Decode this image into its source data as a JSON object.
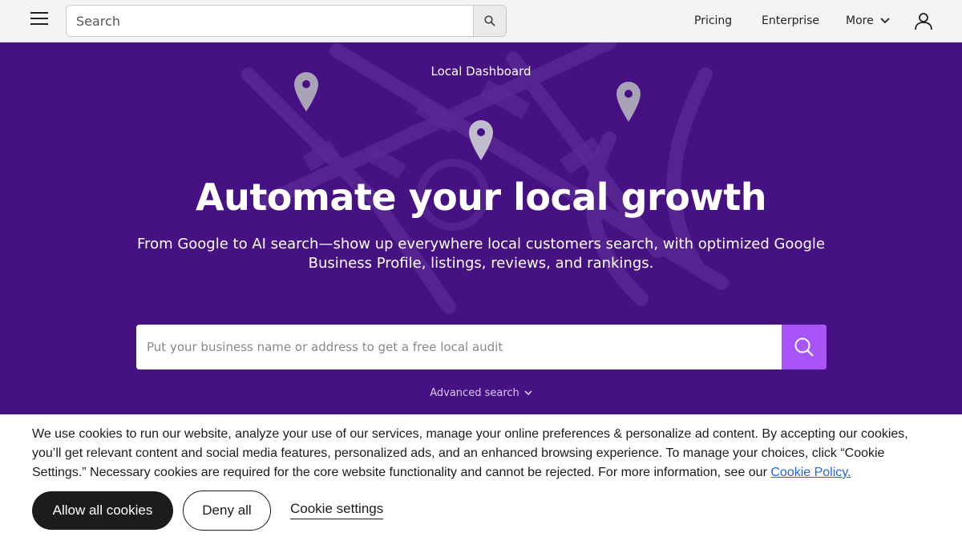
{
  "header": {
    "menu_icon": "hamburger-menu-icon",
    "search": {
      "placeholder": "Search",
      "value": "",
      "icon": "search-icon"
    },
    "nav": {
      "pricing": "Pricing",
      "enterprise": "Enterprise",
      "more": "More"
    },
    "more_icon": "chevron-down-icon",
    "user_icon": "user-account-icon"
  },
  "hero": {
    "kicker": "Local Dashboard",
    "title": "Automate your local growth",
    "subtitle": "From Google to AI search—show up everywhere local customers search, with optimized Google Business Profile, listings, reviews, and rankings.",
    "audit_input": {
      "placeholder": "Put your business name or address to get a free local audit",
      "value": ""
    },
    "audit_button_icon": "search-icon",
    "advanced_search": "Advanced search",
    "colors": {
      "background": "#461283",
      "button": "#a855f7"
    }
  },
  "cookie_banner": {
    "text": "We use cookies to run our website, analyze your use of our services, manage your online preferences & personalize ad content. By accepting our cookies, you’ll get relevant content and social media features, personalized ads, and an enhanced browsing experience. To manage your choices, click “Cookie Settings.” Necessary cookies are required for the core website functionality and cannot be rejected. For more information, see our ",
    "policy_link": "Cookie Policy.",
    "allow_all": "Allow all cookies",
    "deny_all": "Deny all",
    "settings": "Cookie settings"
  }
}
